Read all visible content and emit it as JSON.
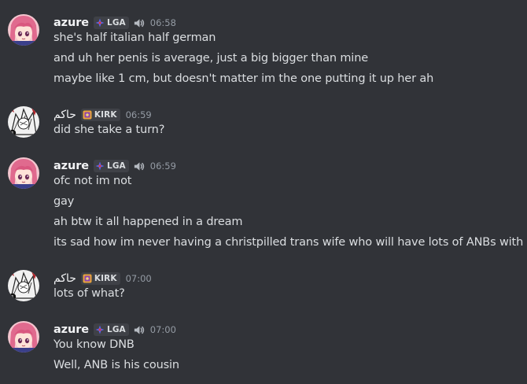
{
  "messages": [
    {
      "username": "azure",
      "tag": "LGA",
      "time": "06:58",
      "lines": [
        "she's half italian half german",
        "and uh her penis is average, just a big bigger than mine",
        "maybe like 1 cm, but doesn't matter im the one putting it up her ah"
      ]
    },
    {
      "username": "حاكم",
      "tag": "KIRK",
      "time": "06:59",
      "lines": [
        "did she take a turn?"
      ]
    },
    {
      "username": "azure",
      "tag": "LGA",
      "time": "06:59",
      "lines": [
        "ofc not im not",
        "gay",
        "ah btw it all happened in a dream",
        "its sad how im never having a christpilled trans wife who will have lots of ANBs with me"
      ]
    },
    {
      "username": "حاكم",
      "tag": "KIRK",
      "time": "07:00",
      "lines": [
        "lots of what?"
      ]
    },
    {
      "username": "azure",
      "tag": "LGA",
      "time": "07:00",
      "lines": [
        "You know DNB",
        "Well, ANB is his cousin"
      ]
    }
  ],
  "colors": {
    "background": "#313338",
    "username": "#f2f3f5",
    "message_text": "#dbdee1",
    "timestamp": "#949ba4",
    "tag_background": "#3f4147",
    "lga_tag_icon": "#5865f2",
    "kirk_tag_icon": "#e6a23c"
  },
  "icons": {
    "lga_tag": "clan-badge-icon",
    "kirk_tag": "clan-badge-icon",
    "speaker": "speaker-icon"
  }
}
